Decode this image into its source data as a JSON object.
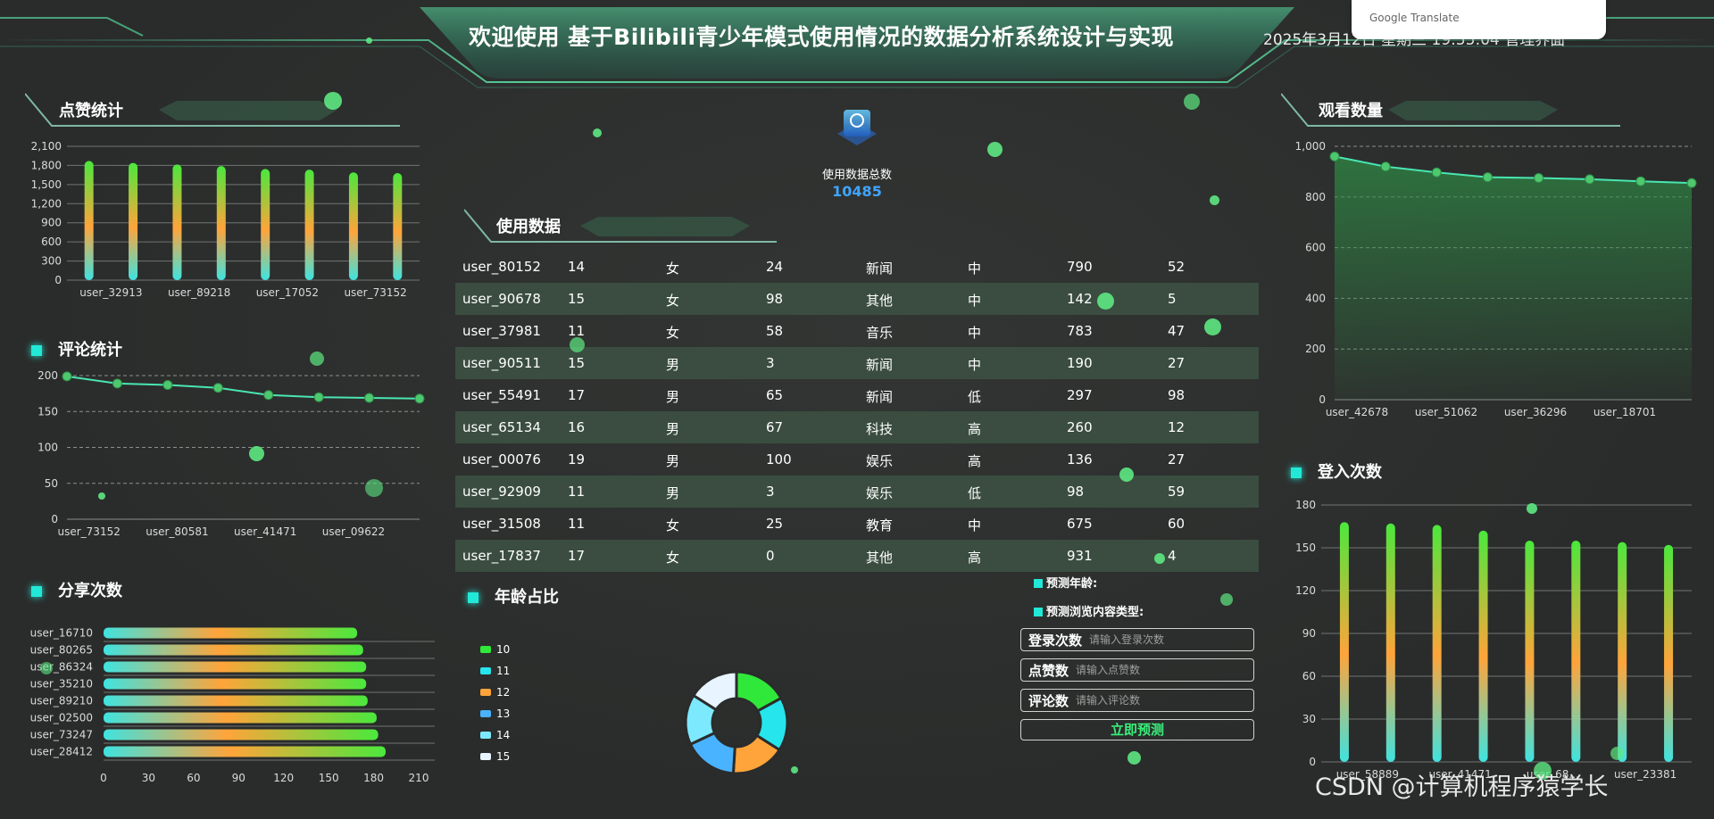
{
  "header": {
    "title": "欢迎使用 基于Bilibili青少年模式使用情况的数据分析系统设计与实现",
    "datetime": "2025年3月12日 星期三 19:55:04 管理界面",
    "translate_widget": "Google Translate"
  },
  "panels": {
    "likes": {
      "title": "点赞统计"
    },
    "comments": {
      "title": "评论统计"
    },
    "shares": {
      "title": "分享次数"
    },
    "usage": {
      "title": "使用数据"
    },
    "age": {
      "title": "年龄占比"
    },
    "views": {
      "title": "观看数量"
    },
    "logins": {
      "title": "登入次数"
    }
  },
  "total": {
    "label": "使用数据总数",
    "value": "10485"
  },
  "table": {
    "rows": [
      [
        "user_80152",
        "14",
        "女",
        "24",
        "新闻",
        "中",
        "790",
        "52"
      ],
      [
        "user_90678",
        "15",
        "女",
        "98",
        "其他",
        "中",
        "142",
        "5"
      ],
      [
        "user_37981",
        "11",
        "女",
        "58",
        "音乐",
        "中",
        "783",
        "47"
      ],
      [
        "user_90511",
        "15",
        "男",
        "3",
        "新闻",
        "中",
        "190",
        "27"
      ],
      [
        "user_55491",
        "17",
        "男",
        "65",
        "新闻",
        "低",
        "297",
        "98"
      ],
      [
        "user_65134",
        "16",
        "男",
        "67",
        "科技",
        "高",
        "260",
        "12"
      ],
      [
        "user_00076",
        "19",
        "男",
        "100",
        "娱乐",
        "高",
        "136",
        "27"
      ],
      [
        "user_92909",
        "11",
        "男",
        "3",
        "娱乐",
        "低",
        "98",
        "59"
      ],
      [
        "user_31508",
        "11",
        "女",
        "25",
        "教育",
        "中",
        "675",
        "60"
      ],
      [
        "user_17837",
        "17",
        "女",
        "0",
        "其他",
        "高",
        "931",
        "4"
      ]
    ]
  },
  "prediction": {
    "age_label": "预测年龄:",
    "type_label": "预测浏览内容类型:",
    "login_label": "登录次数",
    "login_placeholder": "请输入登录次数",
    "like_label": "点赞数",
    "like_placeholder": "请输入点赞数",
    "comment_label": "评论数",
    "comment_placeholder": "请输入评论数",
    "button": "立即预测"
  },
  "watermark": "CSDN @计算机程序猿学长",
  "colors": {
    "accent": "#22e8d7",
    "green": "#4be83d",
    "orange": "#ffa43a",
    "cyan": "#3fe3e0",
    "blue": "#3fa4ff"
  },
  "chart_data": [
    {
      "id": "likes",
      "type": "bar",
      "categories": [
        "user_32913",
        "",
        "user_89218",
        "",
        "user_17052",
        "",
        "user_73152",
        ""
      ],
      "values": [
        1870,
        1840,
        1815,
        1790,
        1745,
        1735,
        1690,
        1680
      ],
      "yticks": [
        0,
        300,
        600,
        900,
        1200,
        1500,
        1800,
        2100
      ],
      "ylim": [
        0,
        2100
      ]
    },
    {
      "id": "comments",
      "type": "line",
      "categories": [
        "user_73152",
        "",
        "user_80581",
        "",
        "user_41471",
        "",
        "user_09622",
        ""
      ],
      "values": [
        199,
        189,
        187,
        183,
        173,
        170,
        169,
        168
      ],
      "yticks": [
        0,
        50,
        100,
        150,
        200
      ],
      "ylim": [
        0,
        210
      ]
    },
    {
      "id": "shares",
      "type": "bar",
      "categories": [
        "user_16710",
        "user_80265",
        "user_86324",
        "user_35210",
        "user_89210",
        "user_02500",
        "user_73247",
        "user_28412"
      ],
      "values": [
        169,
        173,
        175,
        175,
        176,
        182,
        183,
        188
      ],
      "xticks": [
        0,
        30,
        60,
        90,
        120,
        150,
        180,
        210
      ],
      "xlim": [
        0,
        210
      ]
    },
    {
      "id": "age",
      "type": "pie",
      "labels": [
        "10",
        "11",
        "12",
        "13",
        "14",
        "15"
      ],
      "values": [
        17,
        17,
        17,
        17,
        16,
        16
      ],
      "colors": [
        "#2fe83a",
        "#26e5ec",
        "#ffa43a",
        "#49b3ff",
        "#7de9ff",
        "#e8f4ff"
      ]
    },
    {
      "id": "views",
      "type": "area",
      "categories": [
        "user_42678",
        "",
        "user_51062",
        "",
        "user_36296",
        "",
        "user_18701",
        ""
      ],
      "values": [
        960,
        920,
        897,
        878,
        875,
        870,
        862,
        855
      ],
      "yticks": [
        0,
        200,
        400,
        600,
        800,
        1000
      ],
      "ylim": [
        0,
        1000
      ]
    },
    {
      "id": "logins",
      "type": "bar",
      "categories": [
        "user_58889",
        "",
        "user_41471",
        "",
        "user_68...",
        "",
        "user_23381",
        ""
      ],
      "values": [
        168,
        167,
        166,
        162,
        155,
        155,
        154,
        152
      ],
      "yticks": [
        0,
        30,
        60,
        90,
        120,
        150,
        180
      ],
      "ylim": [
        0,
        180
      ]
    }
  ]
}
